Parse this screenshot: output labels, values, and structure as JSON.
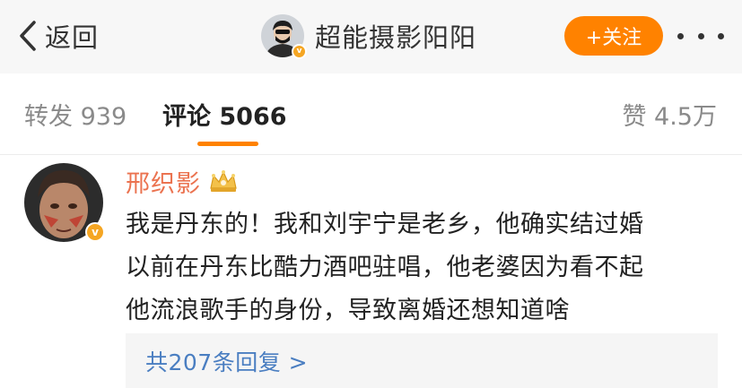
{
  "nav": {
    "back_label": "返回",
    "profile_name": "超能摄影阳阳",
    "follow_label": "+关注",
    "verified_badge": "v"
  },
  "tabs": {
    "repost": "转发 939",
    "comment": "评论 5066",
    "like": "赞 4.5万"
  },
  "comment": {
    "author": "邢织影",
    "verified_badge": "v",
    "lines": [
      "我是丹东的！我和刘宇宁是老乡，他确实结过婚",
      "以前在丹东比酷力酒吧驻唱，他老婆因为看不起",
      "他流浪歌手的身份，导致离婚还想知道啥"
    ],
    "replies_label": "共207条回复 >"
  },
  "colors": {
    "accent": "#ff8200",
    "author_name": "#eb7350",
    "link": "#4a7ec1",
    "verified": "#f5a623"
  },
  "icons": [
    "back-chevron-icon",
    "profile-avatar",
    "verified-badge-icon",
    "more-dots-icon",
    "crown-badge-icon",
    "comment-avatar"
  ]
}
